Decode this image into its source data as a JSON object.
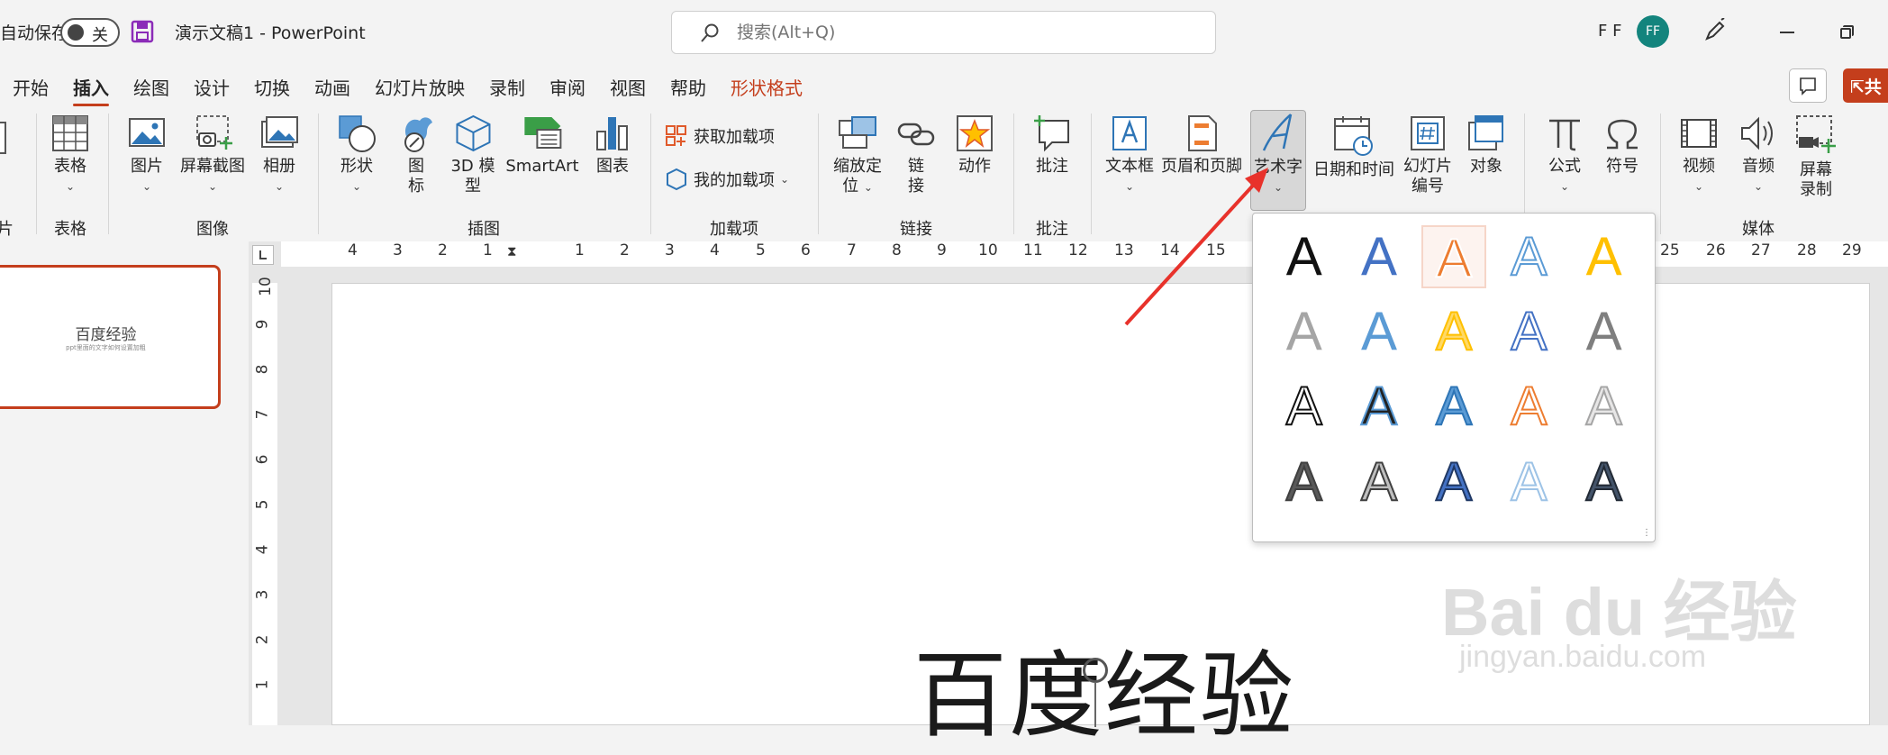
{
  "titlebar": {
    "autosave_label": "自动保存",
    "autosave_state": "关",
    "doc_title": "演示文稿1  -  PowerPoint",
    "search_placeholder": "搜索(Alt+Q)",
    "user_name": "F F",
    "avatar_initials": "FF"
  },
  "tabs": [
    "开始",
    "插入",
    "绘图",
    "设计",
    "切换",
    "动画",
    "幻灯片放映",
    "录制",
    "审阅",
    "视图",
    "帮助",
    "形状格式"
  ],
  "active_tab": "插入",
  "share_label": "共",
  "ribbon": {
    "groups": {
      "slides_fragment": "片",
      "tables": "表格",
      "images": "图像",
      "illustrations": "插图",
      "addins": "加载项",
      "links": "链接",
      "comments": "批注",
      "media": "媒体"
    },
    "buttons": {
      "table": "表格",
      "pictures": "图片",
      "screenshot": "屏幕截图",
      "album": "相册",
      "shapes": "形状",
      "icons_l1": "图",
      "icons_l2": "标",
      "model3d_l1": "3D 模",
      "model3d_l2": "型",
      "smartart": "SmartArt",
      "chart": "图表",
      "get_addins": "获取加载项",
      "my_addins": "我的加载项",
      "zoom_l1": "缩放定",
      "zoom_l2": "位",
      "link_l1": "链",
      "link_l2": "接",
      "action": "动作",
      "comment": "批注",
      "textbox": "文本框",
      "header_footer": "页眉和页脚",
      "wordart": "艺术字",
      "datetime": "日期和时间",
      "slide_number_l1": "幻灯片",
      "slide_number_l2": "编号",
      "object": "对象",
      "equation": "公式",
      "symbol": "符号",
      "video": "视频",
      "audio": "音频",
      "screen_record_l1": "屏幕",
      "screen_record_l2": "录制"
    }
  },
  "ruler": {
    "h_ticks": [
      "4",
      "3",
      "2",
      "1",
      "1",
      "2",
      "3",
      "4",
      "5",
      "6",
      "7",
      "8",
      "9",
      "10",
      "11",
      "12",
      "13",
      "14",
      "15",
      "25",
      "26",
      "27",
      "28",
      "29"
    ],
    "v_ticks": [
      "10",
      "9",
      "8",
      "7",
      "6",
      "5",
      "4",
      "3",
      "2",
      "1"
    ]
  },
  "thumbnail": {
    "title": "百度经验",
    "subtitle": "ppt里面的文字如何设置加粗"
  },
  "slide": {
    "title": "百度经验"
  },
  "wordart_gallery": {
    "glyph": "A",
    "styles": [
      {
        "fill": "#111111",
        "stroke": "none"
      },
      {
        "fill": "#4472c4",
        "stroke": "none"
      },
      {
        "fill": "#ed7d31",
        "stroke": "#ffffff"
      },
      {
        "fill": "#ffffff",
        "stroke": "#5b9bd5"
      },
      {
        "fill": "#ffc000",
        "stroke": "none"
      },
      {
        "fill": "#a5a5a5",
        "stroke": "none"
      },
      {
        "fill": "#5b9bd5",
        "stroke": "none"
      },
      {
        "fill": "#ffd966",
        "stroke": "#ffc000"
      },
      {
        "fill": "#ffffff",
        "stroke": "#4472c4"
      },
      {
        "fill": "#7f7f7f",
        "stroke": "none"
      },
      {
        "fill": "#ffffff",
        "stroke": "#111111"
      },
      {
        "fill": "#222222",
        "stroke": "#5b9bd5"
      },
      {
        "fill": "#5b9bd5",
        "stroke": "#2e75b6"
      },
      {
        "fill": "#ffffff",
        "stroke": "#ed7d31"
      },
      {
        "fill": "#e7e6e6",
        "stroke": "#a5a5a5"
      },
      {
        "fill": "#595959",
        "stroke": "#404040"
      },
      {
        "fill": "#bfbfbf",
        "stroke": "#404040"
      },
      {
        "fill": "#4472c4",
        "stroke": "#203864"
      },
      {
        "fill": "#ffffff",
        "stroke": "#9dc3e6"
      },
      {
        "fill": "#44546a",
        "stroke": "#222a35"
      }
    ]
  },
  "watermark": {
    "brand": "Bai du 经验",
    "url": "jingyan.baidu.com"
  },
  "colors": {
    "accent": "#c43e1c",
    "avatar": "#13847d"
  }
}
